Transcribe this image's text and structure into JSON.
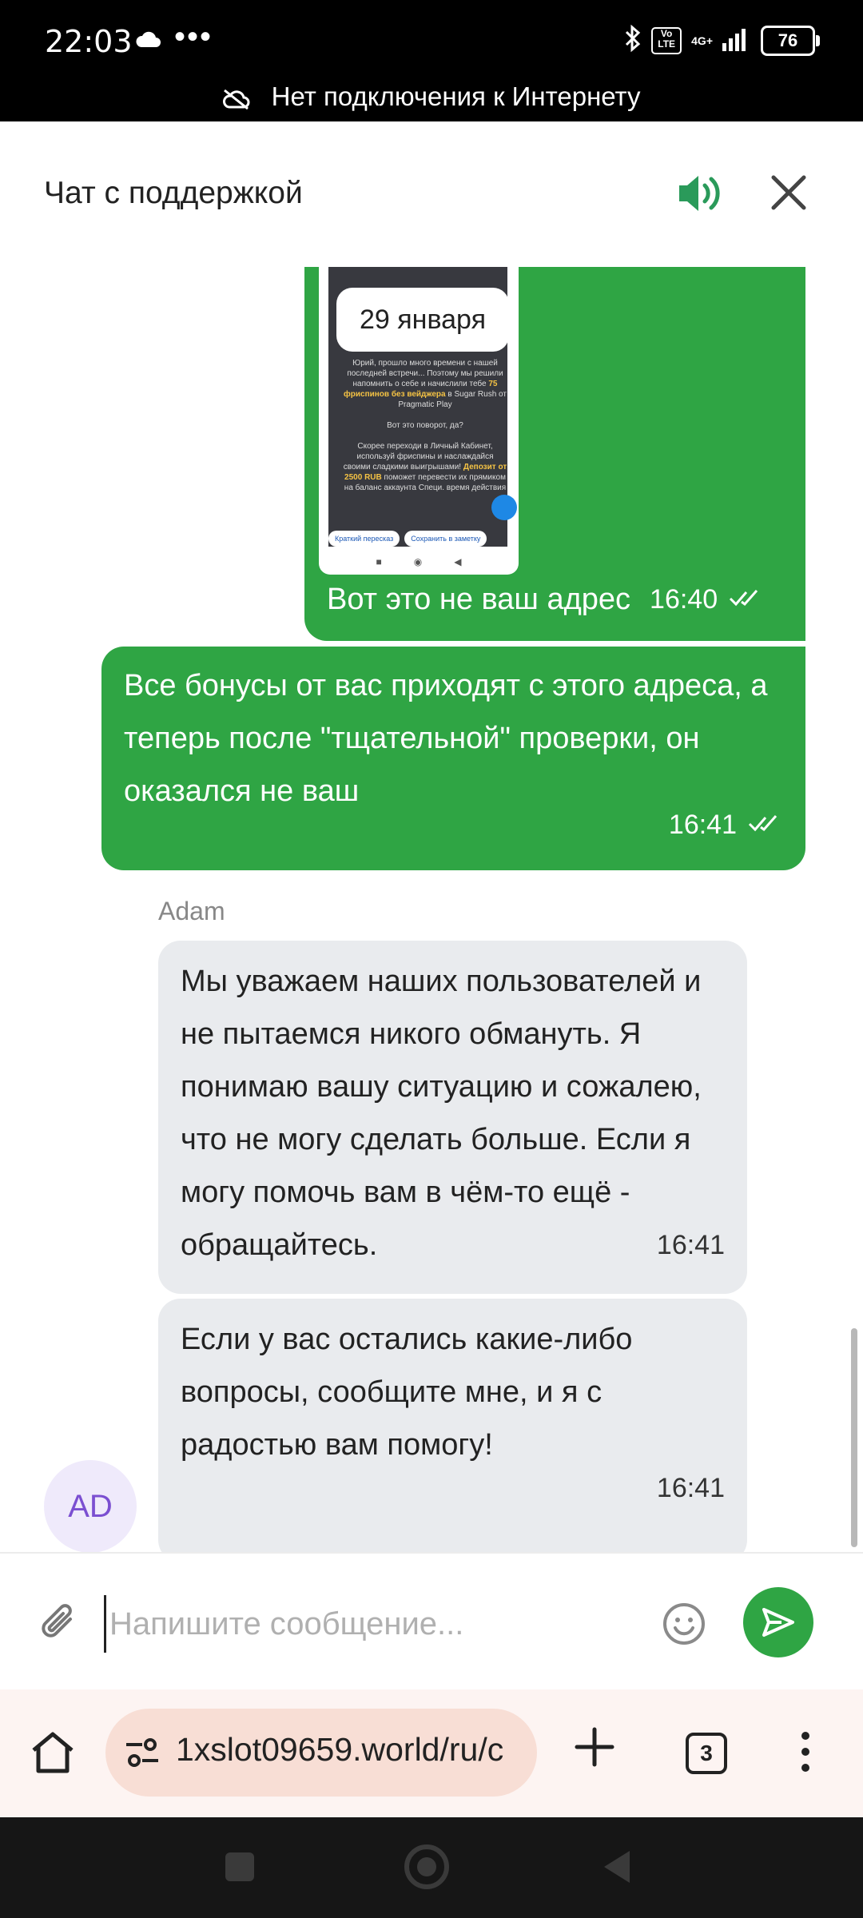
{
  "status_bar": {
    "time": "22:03",
    "dots": "•••",
    "network": "4G+",
    "volte": "Vo LTE",
    "battery": "76",
    "offline_message": "Нет подключения к Интернету",
    "icons": [
      "cloud-icon",
      "bluetooth-icon",
      "signal-icon",
      "battery-icon",
      "no-internet-icon"
    ]
  },
  "chat_header": {
    "title": "Чат с поддержкой",
    "icons": [
      "sound-icon",
      "close-icon"
    ]
  },
  "messages": [
    {
      "direction": "outgoing",
      "type": "image",
      "image": {
        "date_label": "29 января",
        "text_line1": "Юрий, прошло много времени с нашей последней встречи... Поэтому мы решили напомнить о себе и начислили тебе",
        "text_highlight1": "75 фриспинов без вейджера",
        "text_line2": "в Sugar Rush от Pragmatic Play",
        "text_line3": "Вот это поворот, да?",
        "text_line4": "Скорее переходи в Личный Кабинет, используй фриспины и наслаждайся своими сладкими выигрышами!",
        "text_highlight2": "Депозит от 2500 RUB",
        "text_line5": "поможет перевести их прямиком на баланс аккаунта",
        "text_line6": "Специ. время действия",
        "chip1": "Краткий пересказ",
        "chip2": "Сохранить в заметку"
      },
      "caption": "Вот это не ваш адрес",
      "time": "16:40",
      "status": "read"
    },
    {
      "direction": "outgoing",
      "text": "Все бонусы от вас приходят с этого адреса, а теперь после \"тщательной\" проверки, он оказался не ваш",
      "time": "16:41",
      "status": "read"
    },
    {
      "direction": "incoming",
      "sender": "Adam",
      "text": "Мы уважаем наших пользователей и не пытаемся никого обмануть. Я понимаю вашу ситуацию и сожалею, что не могу сделать больше. Если я могу помочь вам в чём-то ещё - обращайтесь.",
      "time": "16:41"
    },
    {
      "direction": "incoming",
      "sender": "Adam",
      "text": "Если у вас остались какие-либо вопросы, сообщите мне, и я с радостью вам помогу!",
      "time": "16:41"
    }
  ],
  "agent": {
    "name": "Adam",
    "avatar_initials": "AD"
  },
  "input_bar": {
    "placeholder": "Напишите сообщение...",
    "value": "",
    "icons": [
      "paperclip-icon",
      "emoji-icon",
      "send-icon"
    ]
  },
  "browser_bar": {
    "url": "1xslot09659.world/ru/c",
    "tab_count": "3",
    "icons": [
      "home-icon",
      "site-settings-icon",
      "new-tab-icon",
      "tabs-icon",
      "more-icon"
    ]
  },
  "nav_bar": {
    "icons": [
      "recents-icon",
      "home-circle-icon",
      "back-icon"
    ]
  },
  "colors": {
    "accent_green": "#2fa544",
    "incoming_bubble": "#e9ebee",
    "avatar_bg": "#efeafb",
    "avatar_text": "#7b4fd1",
    "status_bar_bg": "#000000"
  }
}
